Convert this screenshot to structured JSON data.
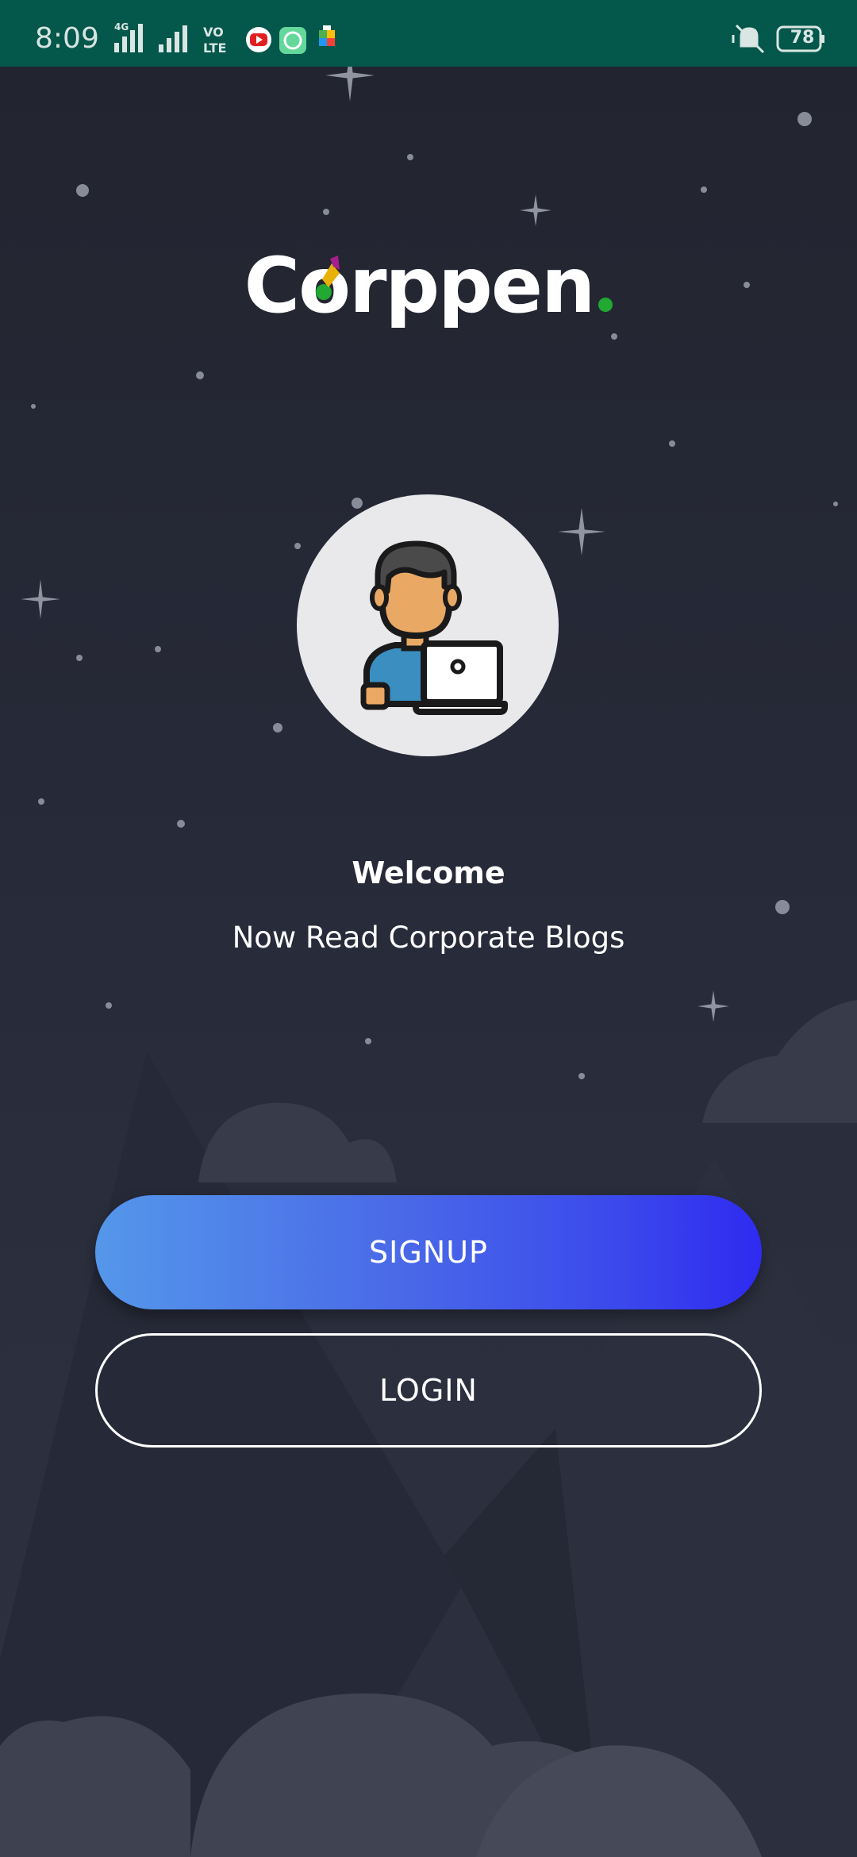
{
  "status_bar": {
    "time": "8:09",
    "network_label": "4G",
    "volte_label": "VO LTE",
    "battery": "78",
    "icons": [
      "signal-icon",
      "signal-icon",
      "volte-icon",
      "youtube-icon",
      "chat-app-icon",
      "play-games-icon",
      "vibrate-icon",
      "battery-icon"
    ]
  },
  "logo": {
    "text": "Corppen",
    "dot_color": "#22a833"
  },
  "avatar": {
    "icon": "user-laptop-icon"
  },
  "welcome": {
    "title": "Welcome",
    "subtitle": "Now Read Corporate Blogs"
  },
  "buttons": {
    "signup_label": "SIGNUP",
    "login_label": "LOGIN"
  },
  "colors": {
    "status_bar": "#04574b",
    "background": "#252836",
    "signup_gradient_start": "#5497ea",
    "signup_gradient_end": "#2f2af0"
  }
}
